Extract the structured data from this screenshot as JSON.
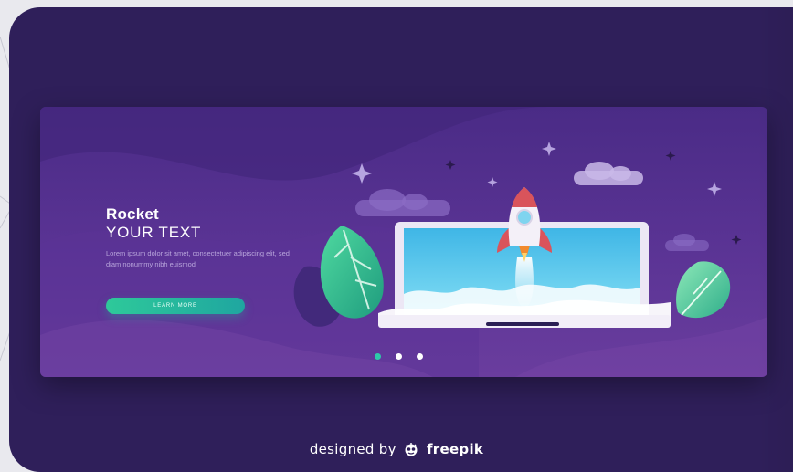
{
  "hero": {
    "title": "Rocket",
    "subtitle": "YOUR TEXT",
    "body": "Lorem ipsum dolor sit amet, consectetuer adipiscing elit, sed diam nonummy nibh euismod",
    "cta_label": "LEARN MORE"
  },
  "pager": {
    "count": 3,
    "active": 0
  },
  "credit": {
    "prefix": "designed by",
    "brand": "freepik"
  },
  "colors": {
    "outer_bg": "#2f1f5a",
    "banner_top": "#4a2b86",
    "banner_bottom": "#6a3d9e",
    "accent_green": "#2ec99a",
    "screen_blue": "#4fc6ea",
    "rocket_red": "#d9545b"
  },
  "icons": [
    "rocket-icon",
    "laptop-icon",
    "cloud-icon",
    "leaf-icon",
    "sparkle-icon",
    "freepik-logo-icon"
  ]
}
